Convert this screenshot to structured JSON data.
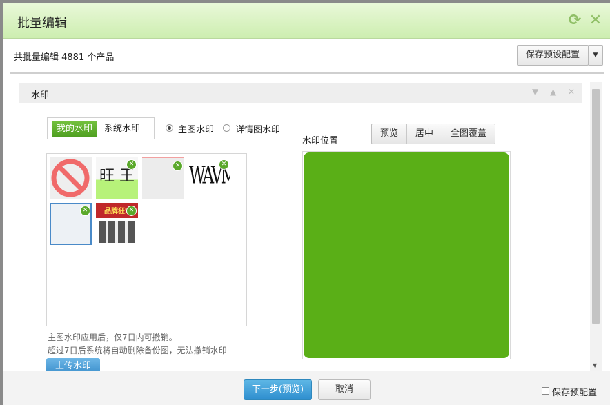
{
  "dialog": {
    "title": "批量编辑",
    "summary": "共批量编辑 4881 个产品",
    "save_preset_label": "保存预设配置",
    "dropdown_icon": "caret-down-icon",
    "refresh_icon": "refresh-icon",
    "close_icon": "close-icon"
  },
  "panel": {
    "title": "水印",
    "tabs": [
      {
        "label": "我的水印",
        "selected": true
      },
      {
        "label": "系统水印",
        "selected": false
      }
    ],
    "radios": [
      {
        "label": "主图水印",
        "checked": true
      },
      {
        "label": "详情图水印",
        "checked": false
      }
    ],
    "hint_line1": "主图水印应用后，仅7日内可撤销。",
    "hint_line2": "超过7日后系统将自动删除备份图，无法撤销水印",
    "upload_label": "上传水印",
    "position_label": "水印位置",
    "preview_buttons": [
      "预览",
      "居中",
      "全图覆盖"
    ],
    "watermarks": [
      {
        "name": "prohibited-sign",
        "deletable": false
      },
      {
        "name": "text",
        "text": "旺 王",
        "deletable": true
      },
      {
        "name": "blank",
        "deletable": true
      },
      {
        "name": "text",
        "text": "WAVMIT",
        "deletable": true
      },
      {
        "name": "blank-bordered",
        "deletable": true
      },
      {
        "name": "promo-banner",
        "text": "品牌狂欢",
        "deletable": true
      }
    ],
    "preview_color": "#5aaf17"
  },
  "footer": {
    "next_label": "下一步(预览)",
    "cancel_label": "取消",
    "save_checkbox_label": "保存预配置",
    "save_checked": false
  },
  "colors": {
    "accent_green": "#5aaf17",
    "primary_blue": "#3b8ecb"
  }
}
